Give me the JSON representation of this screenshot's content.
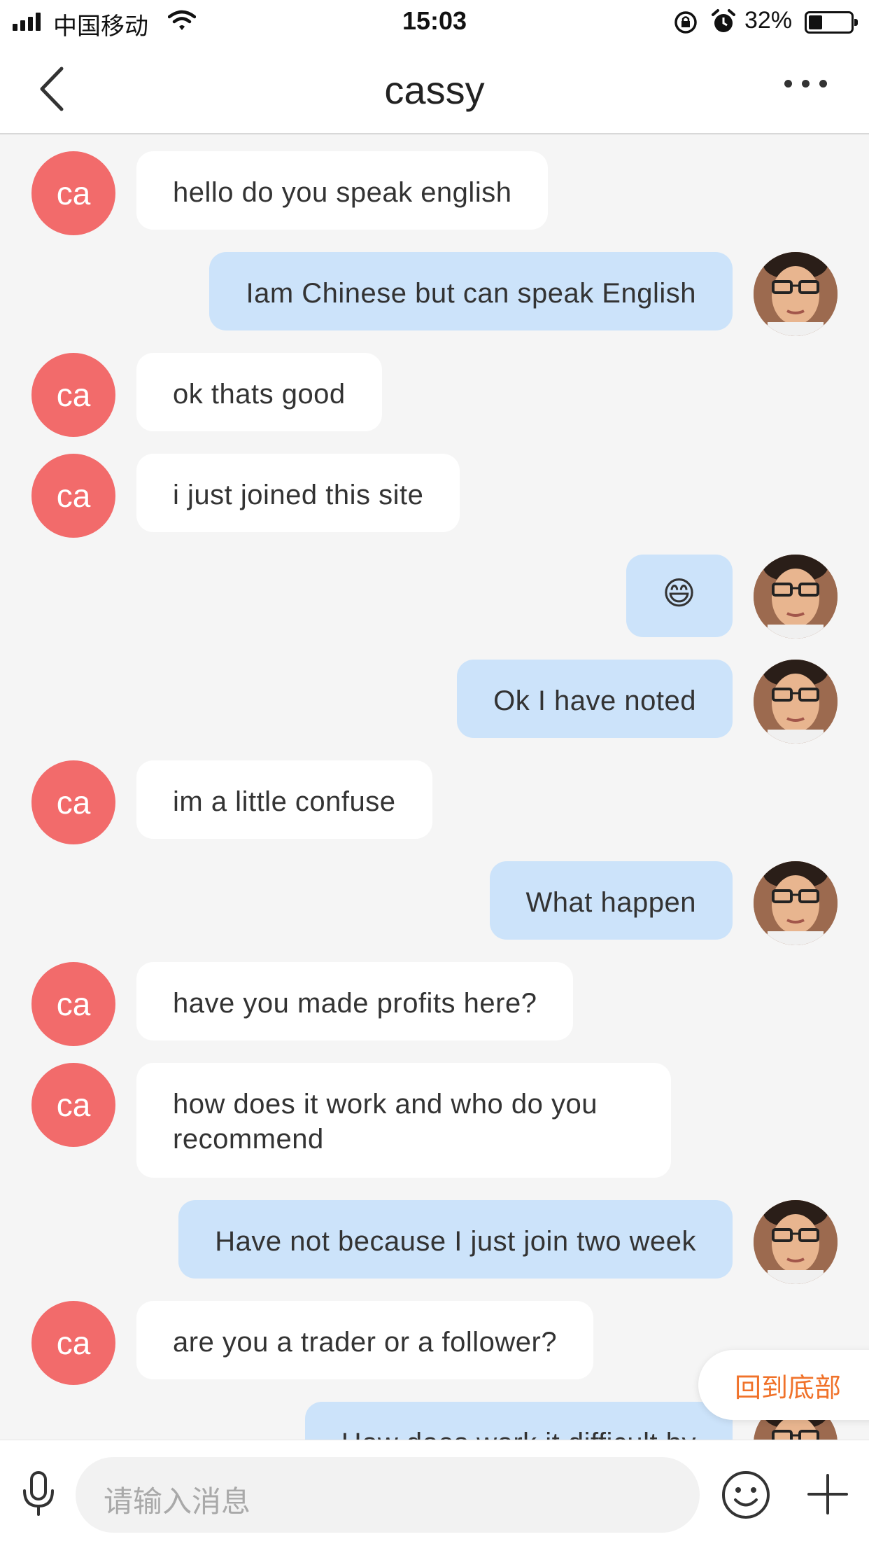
{
  "status_bar": {
    "carrier": "中国移动",
    "time": "15:03",
    "battery_percent": "32%",
    "battery_level": 0.32
  },
  "header": {
    "title": "cassy"
  },
  "messages": [
    {
      "from": "cassy",
      "avatar": "ca",
      "text": "hello do you speak english"
    },
    {
      "from": "me",
      "text": "Iam Chinese but can speak English"
    },
    {
      "from": "cassy",
      "avatar": "ca",
      "text": "ok thats good"
    },
    {
      "from": "cassy",
      "avatar": "ca",
      "text": "i just joined this site"
    },
    {
      "from": "me",
      "text": "😄"
    },
    {
      "from": "me",
      "text": "Ok I have noted"
    },
    {
      "from": "cassy",
      "avatar": "ca",
      "text": "im a little confuse"
    },
    {
      "from": "me",
      "text": "What happen"
    },
    {
      "from": "cassy",
      "avatar": "ca",
      "text": "have you made profits here?"
    },
    {
      "from": "cassy",
      "avatar": "ca",
      "text": "how does it work and who do you recommend"
    },
    {
      "from": "me",
      "text": "Have not because I just join two week"
    },
    {
      "from": "cassy",
      "avatar": "ca",
      "text": "are you a trader or a follower?"
    },
    {
      "from": "me",
      "text": "How does work it difficult by"
    }
  ],
  "back_to_bottom": "回到底部",
  "input": {
    "placeholder": "请输入消息"
  },
  "icons": {
    "back": "chevron-left-icon",
    "more": "more-dots-icon",
    "mic": "microphone-icon",
    "emoji": "smiley-icon",
    "plus": "plus-icon"
  },
  "colors": {
    "incoming_bubble": "#ffffff",
    "outgoing_bubble": "#cce3fa",
    "avatar_bg": "#f26b6b",
    "accent": "#f0722a"
  }
}
